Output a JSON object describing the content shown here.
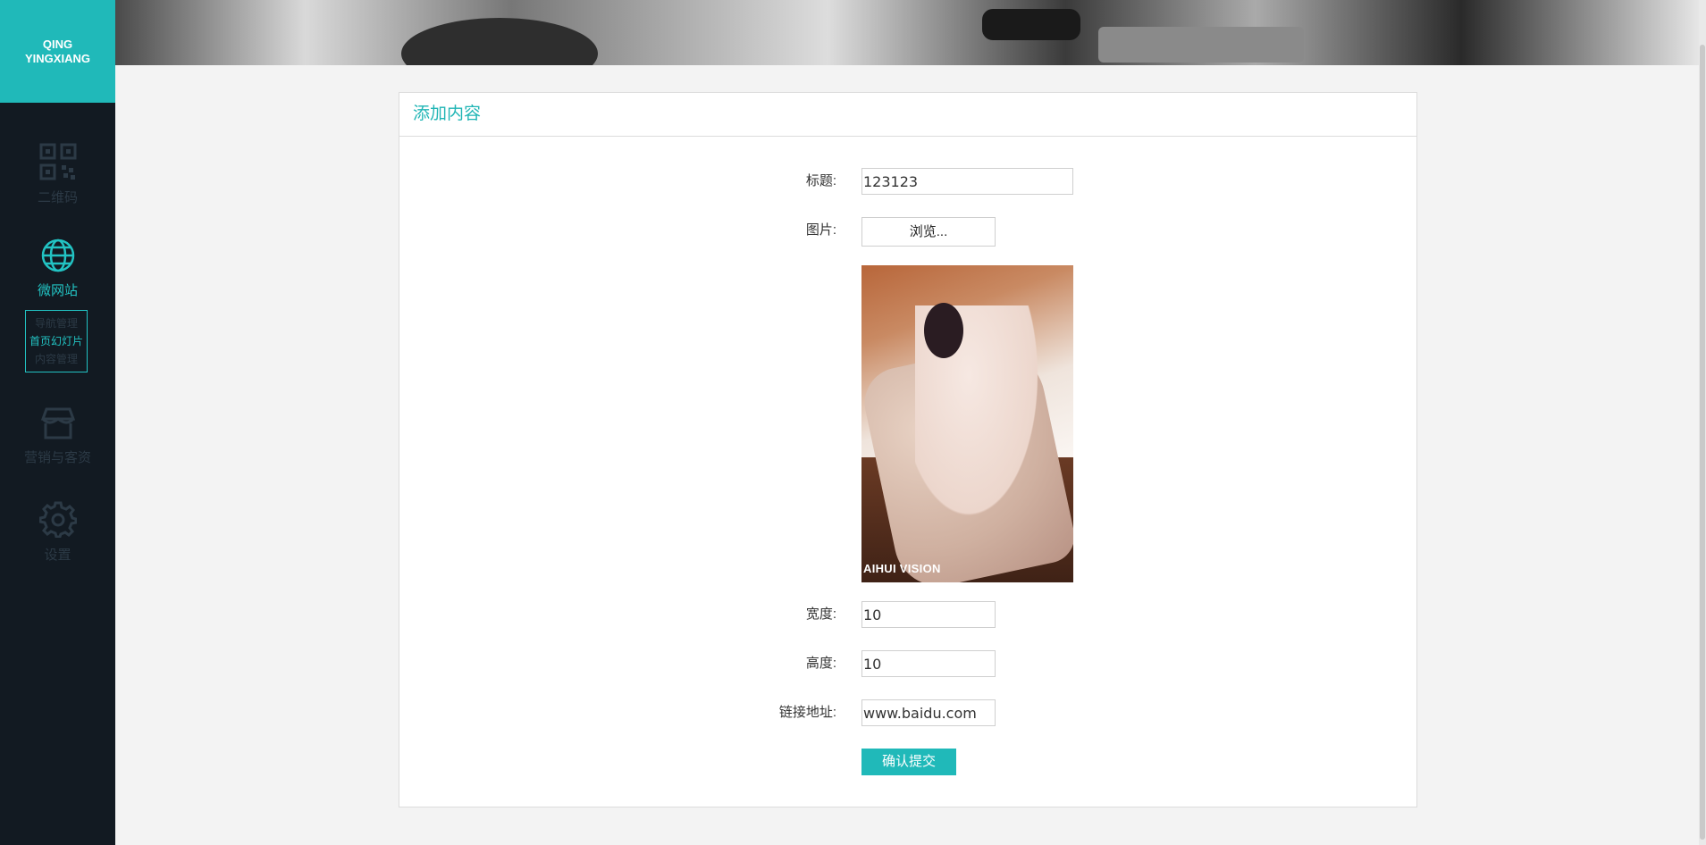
{
  "sidebar": {
    "logo_line1": "QING",
    "logo_line2": "YINGXIANG",
    "items": [
      {
        "label": "二维码",
        "icon": "qr-code-icon"
      },
      {
        "label": "微网站",
        "icon": "globe-icon"
      },
      {
        "label": "营销与客资",
        "icon": "store-icon"
      },
      {
        "label": "设置",
        "icon": "gear-icon"
      }
    ],
    "submenu": [
      {
        "label": "导航管理"
      },
      {
        "label": "首页幻灯片"
      },
      {
        "label": "内容管理"
      }
    ]
  },
  "panel": {
    "title": "添加内容"
  },
  "form": {
    "title_label": "标题:",
    "title_value": "123123",
    "image_label": "图片:",
    "browse_label": "浏览...",
    "preview_caption": "AIHUI VISION",
    "width_label": "宽度:",
    "width_value": "10",
    "height_label": "高度:",
    "height_value": "10",
    "link_label": "链接地址:",
    "link_value": "www.baidu.com",
    "submit_label": "确认提交"
  },
  "colors": {
    "accent": "#20b9b9",
    "sidebar_bg": "#121a22",
    "page_bg": "#f3f3f3"
  }
}
